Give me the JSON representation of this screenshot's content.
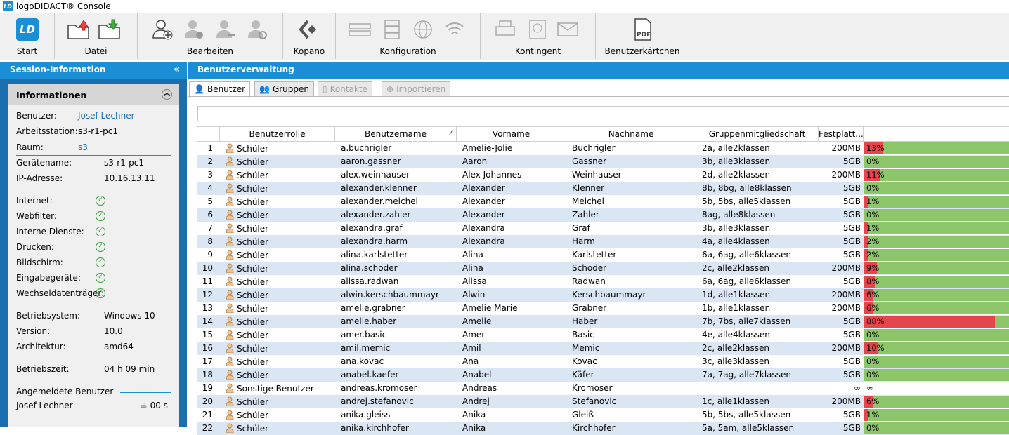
{
  "app": {
    "title": "logoDIDACT® Console",
    "logo": "LD"
  },
  "toolbar": {
    "start": "Start",
    "datei": "Datei",
    "bearbeiten": "Bearbeiten",
    "kopano": "Kopano",
    "konfiguration": "Konfiguration",
    "kontingent": "Kontingent",
    "benutzerkaertchen": "Benutzerkärtchen"
  },
  "session": {
    "title": "Session-Information",
    "info_title": "Informationen",
    "benutzer_label": "Benutzer:",
    "benutzer": "Josef Lechner",
    "arbeitsstation_label": "Arbeitsstation:",
    "arbeitsstation": "s3-r1-pc1",
    "raum_label": "Raum:",
    "raum": "s3",
    "geraetename_label": "Gerätename:",
    "geraetename": "s3-r1-pc1",
    "ip_label": "IP-Adresse:",
    "ip": "10.16.13.11",
    "internet_label": "Internet:",
    "webfilter_label": "Webfilter:",
    "interne_label": "Interne Dienste:",
    "drucken_label": "Drucken:",
    "bildschirm_label": "Bildschirm:",
    "eingabe_label": "Eingabegeräte:",
    "wechsel_label": "Wechseldatenträger:",
    "os_label": "Betriebsystem:",
    "os": "Windows 10",
    "version_label": "Version:",
    "version": "10.0",
    "arch_label": "Architektur:",
    "arch": "amd64",
    "uptime_label": "Betriebszeit:",
    "uptime": "04 h 09 min",
    "logged_label": "Angemeldete Benutzer",
    "logged_user": "Josef Lechner",
    "logged_idle": "00 s"
  },
  "main": {
    "title": "Benutzerverwaltung",
    "tabs": [
      "Benutzer",
      "Gruppen",
      "Kontakte",
      "Importieren"
    ],
    "columns": [
      "Benutzerrolle",
      "Benutzername",
      "Vorname",
      "Nachname",
      "Gruppenmitgliedschaft",
      "Festplatt..."
    ],
    "sort_indicator": "⁄"
  },
  "rows": [
    {
      "n": "1",
      "role": "Schüler",
      "user": "a.buchrigler",
      "first": "Amelie-Jolie",
      "last": "Buchrigler",
      "groups": "2a, alle2klassen",
      "quota": "200MB",
      "pct": "13%",
      "frac": 0.13
    },
    {
      "n": "2",
      "role": "Schüler",
      "user": "aaron.gassner",
      "first": "Aaron",
      "last": "Gassner",
      "groups": "3b, alle3klassen",
      "quota": "5GB",
      "pct": "0%",
      "frac": 0
    },
    {
      "n": "3",
      "role": "Schüler",
      "user": "alex.weinhauser",
      "first": "Alex Johannes",
      "last": "Weinhauser",
      "groups": "2d, alle2klassen",
      "quota": "200MB",
      "pct": "11%",
      "frac": 0.11
    },
    {
      "n": "4",
      "role": "Schüler",
      "user": "alexander.klenner",
      "first": "Alexander",
      "last": "Klenner",
      "groups": "8b, 8bg, alle8klassen",
      "quota": "5GB",
      "pct": "0%",
      "frac": 0
    },
    {
      "n": "5",
      "role": "Schüler",
      "user": "alexander.meichel",
      "first": "Alexander",
      "last": "Meichel",
      "groups": "5b, 5bs, alle5klassen",
      "quota": "5GB",
      "pct": "1%",
      "frac": 0.01
    },
    {
      "n": "6",
      "role": "Schüler",
      "user": "alexander.zahler",
      "first": "Alexander",
      "last": "Zahler",
      "groups": "8ag, alle8klassen",
      "quota": "5GB",
      "pct": "0%",
      "frac": 0
    },
    {
      "n": "7",
      "role": "Schüler",
      "user": "alexandra.graf",
      "first": "Alexandra",
      "last": "Graf",
      "groups": "3b, alle3klassen",
      "quota": "5GB",
      "pct": "1%",
      "frac": 0.01
    },
    {
      "n": "8",
      "role": "Schüler",
      "user": "alexandra.harm",
      "first": "Alexandra",
      "last": "Harm",
      "groups": "4a, alle4klassen",
      "quota": "5GB",
      "pct": "2%",
      "frac": 0.02
    },
    {
      "n": "9",
      "role": "Schüler",
      "user": "alina.karlstetter",
      "first": "Alina",
      "last": "Karlstetter",
      "groups": "6a, 6ag, alle6klassen",
      "quota": "5GB",
      "pct": "2%",
      "frac": 0.02
    },
    {
      "n": "10",
      "role": "Schüler",
      "user": "alina.schoder",
      "first": "Alina",
      "last": "Schoder",
      "groups": "2c, alle2klassen",
      "quota": "200MB",
      "pct": "9%",
      "frac": 0.09
    },
    {
      "n": "11",
      "role": "Schüler",
      "user": "alissa.radwan",
      "first": "Alissa",
      "last": "Radwan",
      "groups": "6a, 6ag, alle6klassen",
      "quota": "5GB",
      "pct": "8%",
      "frac": 0.08
    },
    {
      "n": "12",
      "role": "Schüler",
      "user": "alwin.kerschbaummayr",
      "first": "Alwin",
      "last": "Kerschbaummayr",
      "groups": "1d, alle1klassen",
      "quota": "200MB",
      "pct": "6%",
      "frac": 0.06
    },
    {
      "n": "13",
      "role": "Schüler",
      "user": "amelie.grabner",
      "first": "Amelie Marie",
      "last": "Grabner",
      "groups": "1b, alle1klassen",
      "quota": "200MB",
      "pct": "6%",
      "frac": 0.06
    },
    {
      "n": "14",
      "role": "Schüler",
      "user": "amelie.haber",
      "first": "Amelie",
      "last": "Haber",
      "groups": "7b, 7bs, alle7klassen",
      "quota": "5GB",
      "pct": "88%",
      "frac": 0.88
    },
    {
      "n": "15",
      "role": "Schüler",
      "user": "amer.basic",
      "first": "Amer",
      "last": "Basic",
      "groups": "4e, alle4klassen",
      "quota": "5GB",
      "pct": "0%",
      "frac": 0
    },
    {
      "n": "16",
      "role": "Schüler",
      "user": "amil.memic",
      "first": "Amil",
      "last": "Memic",
      "groups": "2c, alle2klassen",
      "quota": "200MB",
      "pct": "10%",
      "frac": 0.1
    },
    {
      "n": "17",
      "role": "Schüler",
      "user": "ana.kovac",
      "first": "Ana",
      "last": "Kovac",
      "groups": "3c, alle3klassen",
      "quota": "5GB",
      "pct": "0%",
      "frac": 0
    },
    {
      "n": "18",
      "role": "Schüler",
      "user": "anabel.kaefer",
      "first": "Anabel",
      "last": "Käfer",
      "groups": "7a, 7ag, alle7klassen",
      "quota": "5GB",
      "pct": "0%",
      "frac": 0
    },
    {
      "n": "19",
      "role": "Sonstige Benutzer",
      "user": "andreas.kromoser",
      "first": "Andreas",
      "last": "Kromoser",
      "groups": "",
      "quota": "∞",
      "pct": "∞",
      "frac": -1
    },
    {
      "n": "20",
      "role": "Schüler",
      "user": "andrej.stefanovic",
      "first": "Andrej",
      "last": "Stefanovic",
      "groups": "1c, alle1klassen",
      "quota": "200MB",
      "pct": "6%",
      "frac": 0.06
    },
    {
      "n": "21",
      "role": "Schüler",
      "user": "anika.gleiss",
      "first": "Anika",
      "last": "Gleiß",
      "groups": "5b, 5bs, alle5klassen",
      "quota": "5GB",
      "pct": "1%",
      "frac": 0.01
    },
    {
      "n": "22",
      "role": "Schüler",
      "user": "anika.kirchhofer",
      "first": "Anika",
      "last": "Kirchhofer",
      "groups": "5a, 5am, alle5klassen",
      "quota": "5GB",
      "pct": "0%",
      "frac": 0
    }
  ],
  "colors": {
    "accent": "#1a8fd6",
    "bar_used": "#e5454c",
    "bar_free": "#8cc56a",
    "row_alt": "#dbe6f4"
  }
}
